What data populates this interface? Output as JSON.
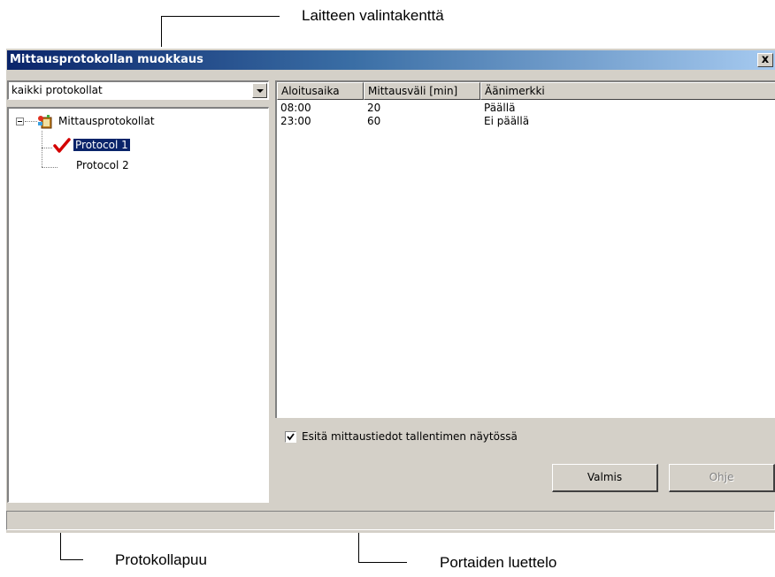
{
  "annotations": {
    "device_selector": "Laitteen valintakenttä",
    "protocol_tree": "Protokollapuu",
    "step_list": "Portaiden luettelo"
  },
  "window": {
    "title": "Mittausprotokollan muokkaus",
    "close_label": "x"
  },
  "device_combo": {
    "value": "kaikki protokollat"
  },
  "tree": {
    "root_label": "Mittausprotokollat",
    "items": [
      {
        "label": "Protocol 1",
        "selected": true,
        "checked": true
      },
      {
        "label": "Protocol 2",
        "selected": false,
        "checked": false
      }
    ]
  },
  "table": {
    "columns": [
      "Aloitusaika",
      "Mittausväli [min]",
      "Äänimerkki"
    ],
    "rows": [
      [
        "08:00",
        "20",
        "Päällä"
      ],
      [
        "23:00",
        "60",
        "Ei päällä"
      ]
    ]
  },
  "options": {
    "show_on_recorder_label": "Esitä mittaustiedot tallentimen näytössä",
    "show_on_recorder_checked": true
  },
  "buttons": {
    "done": "Valmis",
    "help": "Ohje"
  },
  "colors": {
    "titlebar_start": "#0a246a",
    "titlebar_end": "#a6caf0",
    "selection": "#0a246a",
    "face": "#d4d0c8",
    "check_red": "#d40000"
  },
  "icons": [
    "close-icon",
    "dropdown-arrow-icon",
    "collapse-icon",
    "protocol-folder-icon",
    "active-check-icon",
    "checkbox-check-icon"
  ]
}
